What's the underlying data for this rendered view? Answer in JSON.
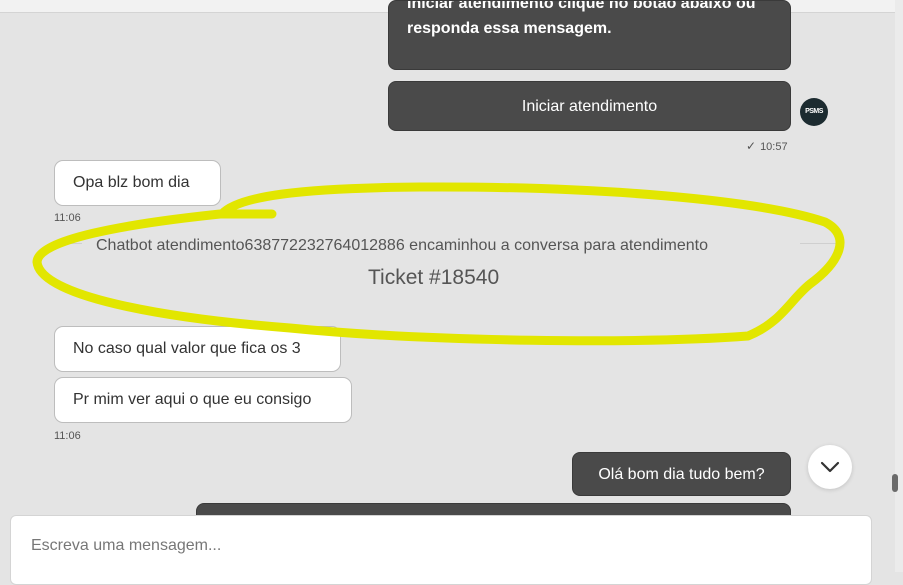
{
  "messages": {
    "top_bubble_line1": "Iniciar atendimento clique no botão abaixo ou",
    "top_bubble_line2": "responda essa mensagem.",
    "start_button": "Iniciar atendimento",
    "avatar_label": "PSMS",
    "sent_time": "10:57",
    "reply1": "Opa blz bom dia",
    "reply1_time": "11:06",
    "system_notice": "Chatbot atendimento638772232764012886 encaminhou a conversa para atendimento",
    "ticket": "Ticket #18540",
    "reply2": "No caso qual valor que fica os 3",
    "reply3": "Pr mim ver aqui o que eu consigo",
    "reply3_time": "11:06",
    "outgoing": "Olá bom dia tudo bem?"
  },
  "composer": {
    "placeholder": "Escreva uma mensagem..."
  },
  "colors": {
    "dark_bubble": "#4a4a4a",
    "highlight_marker": "#e2e600"
  }
}
